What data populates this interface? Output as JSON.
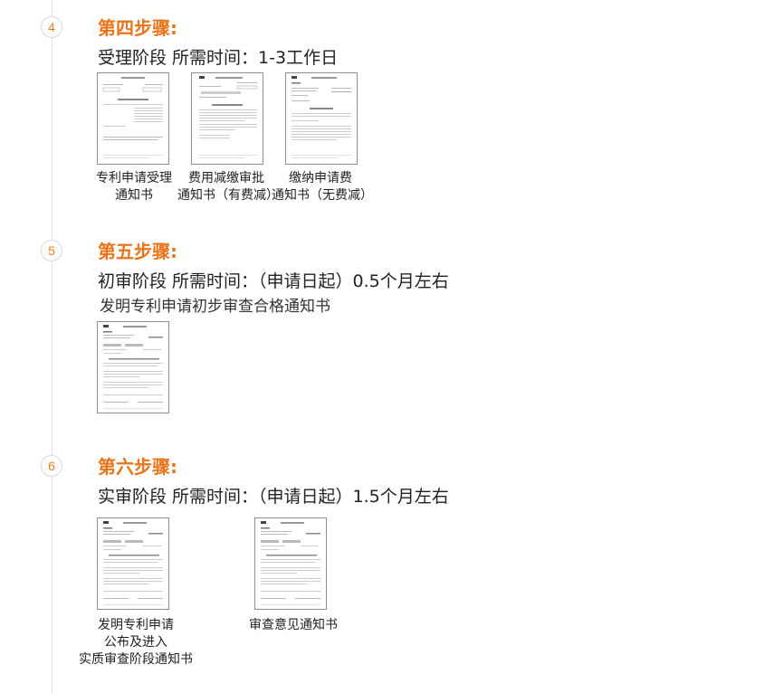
{
  "steps": [
    {
      "number": "4",
      "title": "第四步骤:",
      "stage": "受理阶段  所需时间：1-3工作日",
      "documents": [
        {
          "lines": [
            "专利申请受理",
            "通知书"
          ]
        },
        {
          "lines": [
            "费用减缴审批",
            "通知书（有费减）"
          ]
        },
        {
          "lines": [
            "缴纳申请费",
            "通知书（无费减）"
          ]
        }
      ]
    },
    {
      "number": "5",
      "title": "第五步骤:",
      "stage": "初审阶段 所需时间：（申请日起）0.5个月左右",
      "subtitle": "发明专利申请初步审查合格通知书",
      "documents": [
        {
          "lines": []
        }
      ]
    },
    {
      "number": "6",
      "title": "第六步骤:",
      "stage": "实审阶段 所需时间：（申请日起）1.5个月左右",
      "documents": [
        {
          "lines": [
            "发明专利申请",
            "公布及进入",
            "实质审查阶段通知书"
          ]
        },
        {
          "lines": [
            "审查意见通知书"
          ]
        }
      ]
    }
  ]
}
